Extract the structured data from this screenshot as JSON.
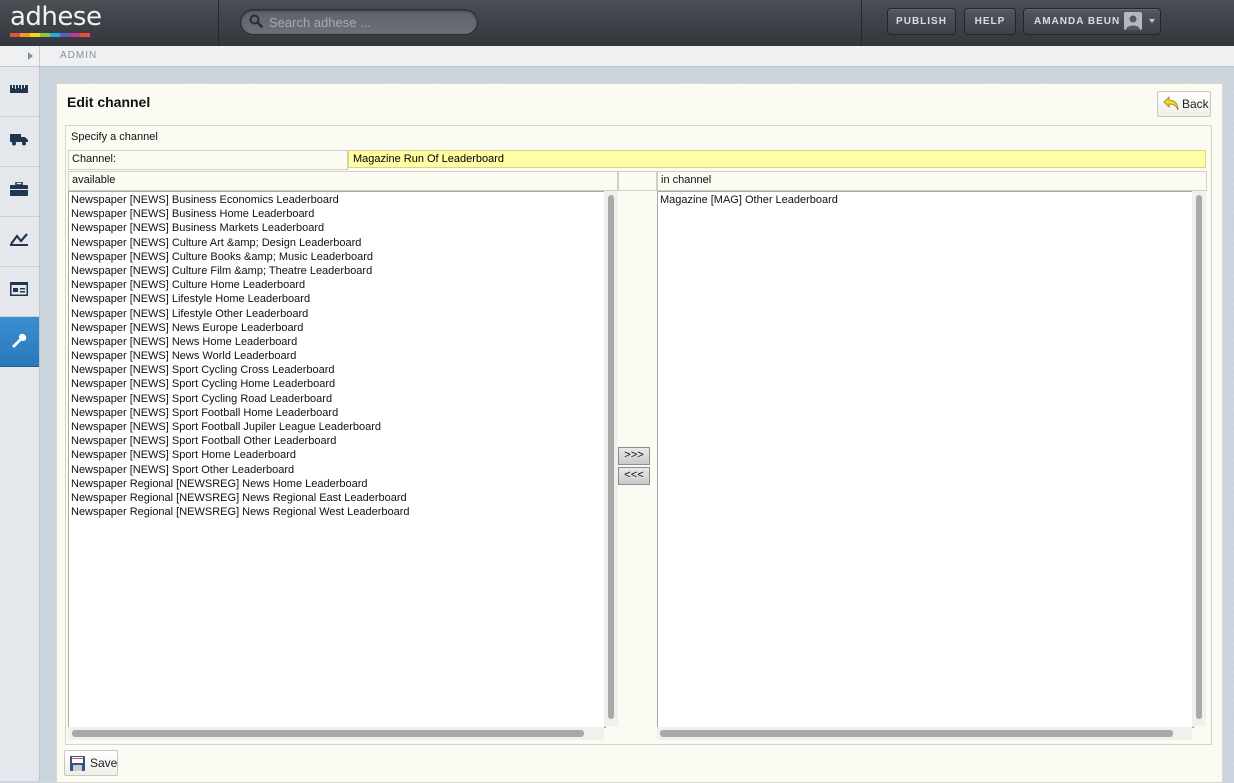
{
  "header": {
    "logo_text": "adhese",
    "logo_stripe_colors": [
      "#e94b3c",
      "#f29b26",
      "#f5d327",
      "#8cc63f",
      "#26a9e0",
      "#5b5fb8",
      "#c2398a",
      "#e94b3c"
    ],
    "search_placeholder": "Search adhese ...",
    "publish_label": "PUBLISH",
    "help_label": "HELP",
    "user_label": "AMANDA BEUN"
  },
  "breadcrumb": {
    "label": "ADMIN"
  },
  "sidebar": {
    "items": [
      {
        "icon": "ruler-icon"
      },
      {
        "icon": "truck-icon"
      },
      {
        "icon": "briefcase-icon"
      },
      {
        "icon": "chart-icon"
      },
      {
        "icon": "layout-icon"
      },
      {
        "icon": "wrench-icon",
        "active": true
      }
    ],
    "active_color": "#2f82c6"
  },
  "page": {
    "title": "Edit channel",
    "back_label": "Back",
    "save_label": "Save",
    "section_legend": "Specify a channel",
    "channel_label": "Channel:",
    "channel_value": "Magazine Run Of Leaderboard",
    "available_header": "available",
    "in_channel_header": "in channel",
    "add_button": ">>>",
    "remove_button": "<<<"
  },
  "available": [
    "Newspaper [NEWS] Business Economics Leaderboard",
    "Newspaper [NEWS] Business Home Leaderboard",
    "Newspaper [NEWS] Business Markets Leaderboard",
    "Newspaper [NEWS] Culture Art &amp; Design Leaderboard",
    "Newspaper [NEWS] Culture Books &amp; Music Leaderboard",
    "Newspaper [NEWS] Culture Film &amp; Theatre Leaderboard",
    "Newspaper [NEWS] Culture Home Leaderboard",
    "Newspaper [NEWS] Lifestyle Home Leaderboard",
    "Newspaper [NEWS] Lifestyle Other Leaderboard",
    "Newspaper [NEWS] News Europe Leaderboard",
    "Newspaper [NEWS] News Home Leaderboard",
    "Newspaper [NEWS] News World Leaderboard",
    "Newspaper [NEWS] Sport Cycling Cross Leaderboard",
    "Newspaper [NEWS] Sport Cycling Home Leaderboard",
    "Newspaper [NEWS] Sport Cycling Road Leaderboard",
    "Newspaper [NEWS] Sport Football Home Leaderboard",
    "Newspaper [NEWS] Sport Football Jupiler League Leaderboard",
    "Newspaper [NEWS] Sport Football Other Leaderboard",
    "Newspaper [NEWS] Sport Home Leaderboard",
    "Newspaper [NEWS] Sport Other Leaderboard",
    "Newspaper Regional [NEWSREG] News Home Leaderboard",
    "Newspaper Regional [NEWSREG] News Regional East Leaderboard",
    "Newspaper Regional [NEWSREG] News Regional West Leaderboard"
  ],
  "in_channel": [
    "Magazine [MAG] Other Leaderboard"
  ]
}
